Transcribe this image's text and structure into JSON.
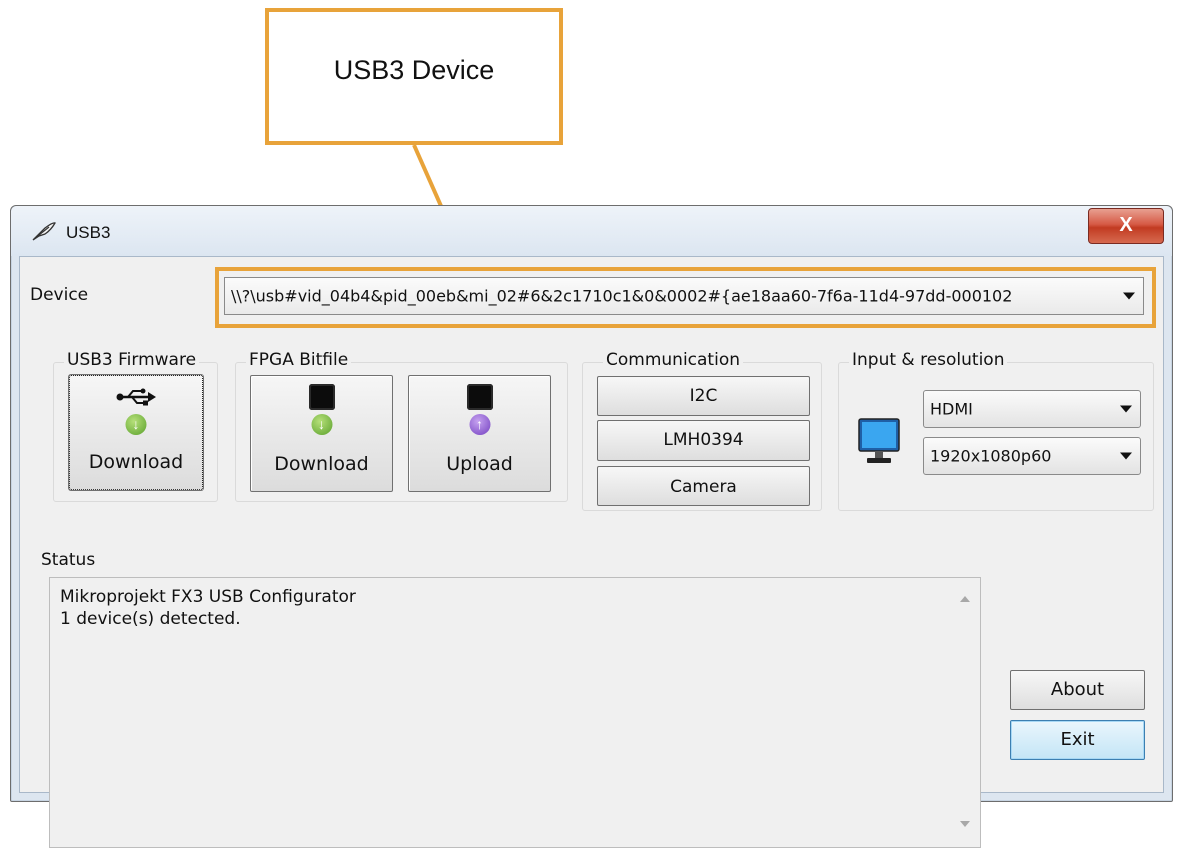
{
  "callout": {
    "text": "USB3 Device",
    "color": "#e8a33a"
  },
  "window": {
    "title": "USB3",
    "app_icon": "feather-icon",
    "close_label": "X"
  },
  "device": {
    "label": "Device",
    "value": "\\\\?\\usb#vid_04b4&pid_00eb&mi_02#6&2c1710c1&0&0002#{ae18aa60-7f6a-11d4-97dd-000102"
  },
  "groups": {
    "usb3_firmware": {
      "label": "USB3 Firmware",
      "download_label": "Download",
      "icon": "usb-icon"
    },
    "fpga_bitfile": {
      "label": "FPGA Bitfile",
      "download_label": "Download",
      "upload_label": "Upload",
      "icon": "chip-icon"
    },
    "communication": {
      "label": "Communication",
      "buttons": [
        "I2C",
        "LMH0394",
        "Camera"
      ]
    },
    "input_resolution": {
      "label": "Input & resolution",
      "input_value": "HDMI",
      "resolution_value": "1920x1080p60",
      "icon": "monitor-icon"
    }
  },
  "status": {
    "label": "Status",
    "lines": [
      "Mikroprojekt FX3 USB Configurator",
      "1 device(s) detected."
    ]
  },
  "actions": {
    "about_label": "About",
    "exit_label": "Exit"
  }
}
